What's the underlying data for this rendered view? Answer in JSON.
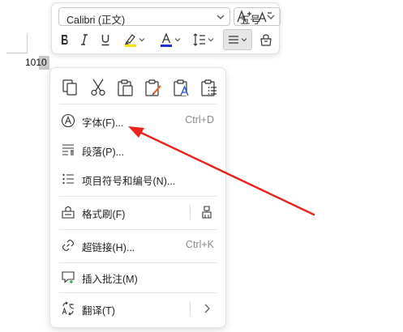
{
  "document": {
    "text": "1010"
  },
  "toolbar": {
    "font_name": "Calibri (正文)",
    "font_size": "五号",
    "buttons": [
      "grow-font",
      "shrink-font",
      "bold",
      "italic",
      "underline",
      "highlight",
      "font-color",
      "line-spacing",
      "align",
      "styles"
    ],
    "highlight_color": "#f5e400",
    "font_color": "#1f2fd8"
  },
  "paste_options": [
    "copy-icon",
    "cut-icon",
    "paste-icon",
    "paste-keep-format-icon",
    "paste-text-only-icon",
    "paste-list-icon"
  ],
  "menu": {
    "font": {
      "label": "字体(F)...",
      "shortcut": "Ctrl+D"
    },
    "paragraph": {
      "label": "段落(P)..."
    },
    "bullets": {
      "label": "项目符号和编号(N)..."
    },
    "format_painter": {
      "label": "格式刷(F)"
    },
    "hyperlink": {
      "label": "超链接(H)...",
      "shortcut": "Ctrl+K"
    },
    "comment": {
      "label": "插入批注(M)"
    },
    "translate": {
      "label": "翻译(T)"
    }
  },
  "colors": {
    "annotation_arrow": "#e8231c",
    "accent": "#1f2fd8"
  }
}
